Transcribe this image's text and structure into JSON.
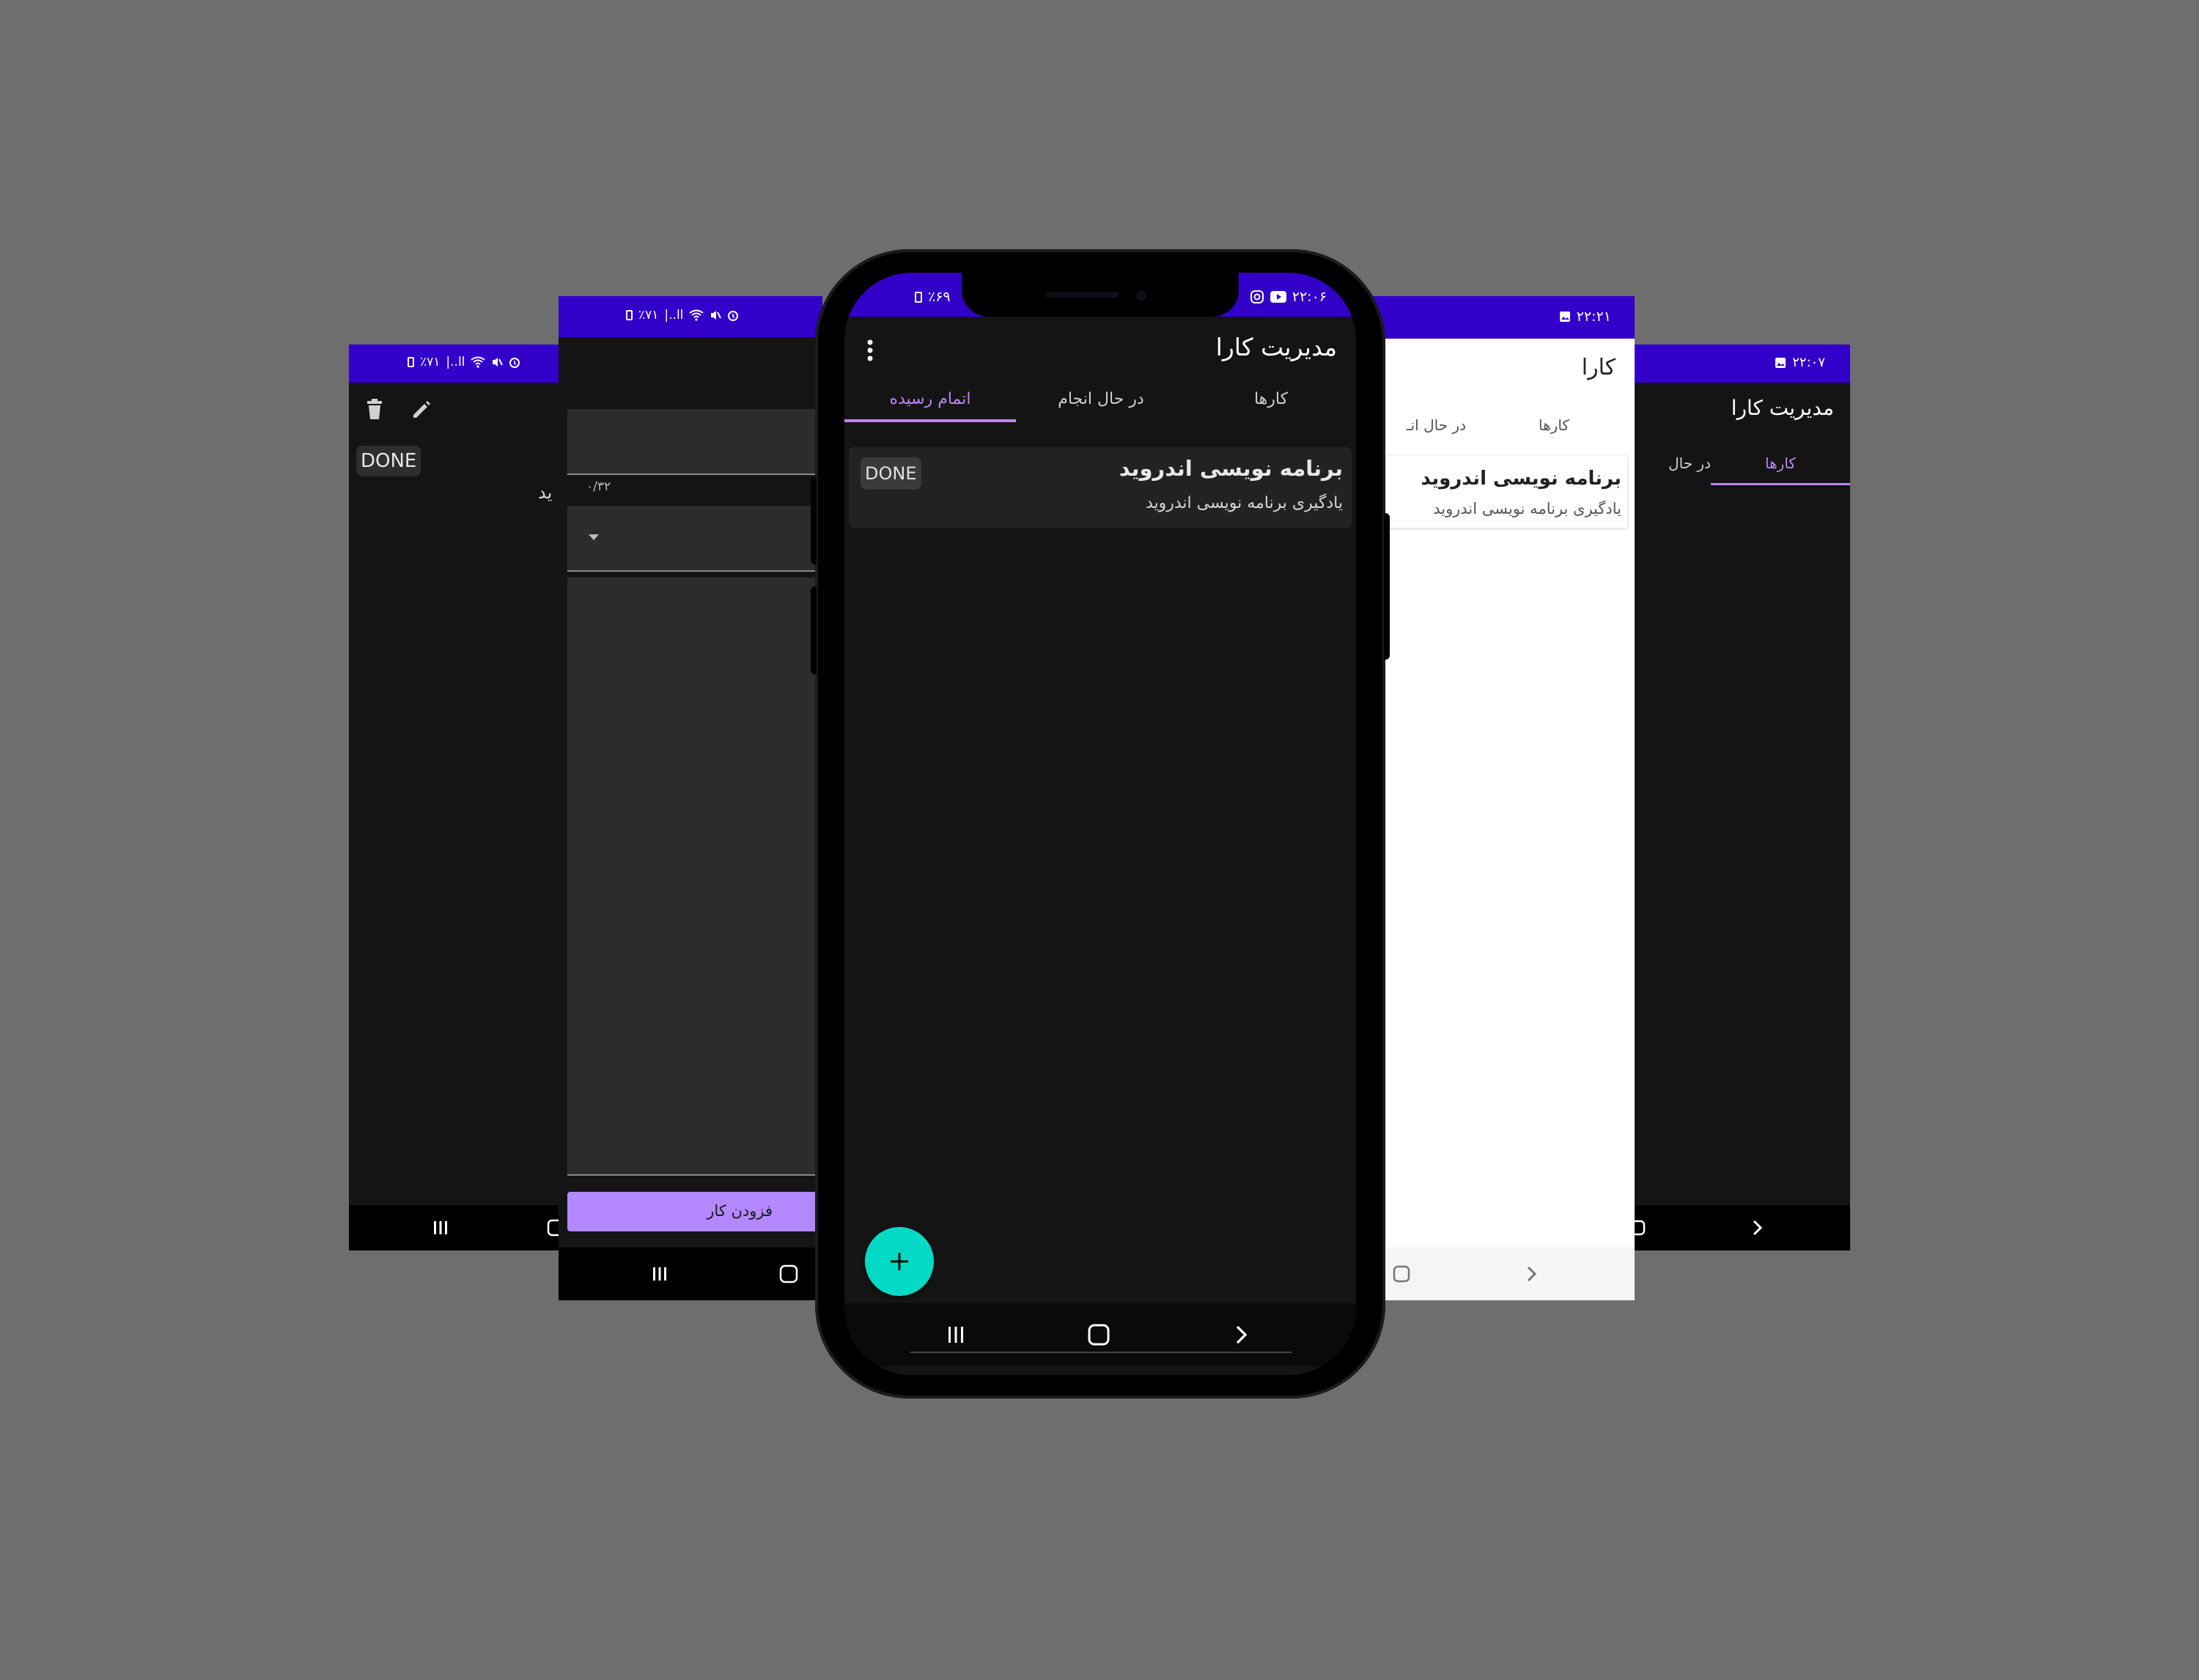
{
  "accent_purple": "#3200c8",
  "tab_accent": "#bb86fc",
  "fab_color": "#03dac5",
  "screen1": {
    "status": {
      "battery": "٪۷۱",
      "signal": "|..ll"
    },
    "done_label": "DONE",
    "partial_text": "ید"
  },
  "screen2": {
    "status": {
      "battery": "٪۷۱",
      "signal": "|..ll"
    },
    "char_counter": "۰/۳۲",
    "submit_button": "فزودن کار"
  },
  "main": {
    "status": {
      "time": "۲۲:۰۶",
      "battery": "٪۶۹"
    },
    "app_title": "مدیریت کارا",
    "tabs": [
      {
        "label": "کارها",
        "active": false
      },
      {
        "label": "در حال انجام",
        "active": false
      },
      {
        "label": "اتمام رسیده",
        "active": true
      }
    ],
    "task": {
      "title": "برنامه نویسی اندروید",
      "description": "یادگیری برنامه نویسی اندروید",
      "status_badge": "DONE"
    },
    "fab_icon": "plus-icon"
  },
  "screen4": {
    "status": {
      "time": "۲۲:۲۱"
    },
    "app_title_partial": "کارا",
    "tabs": [
      "کارها",
      "در حال انـ"
    ],
    "task": {
      "title": "برنامه نویسی اندروید",
      "description": "یادگیری برنامه نویسی اندروید"
    }
  },
  "screen5": {
    "status": {
      "time": "۲۲:۰۷"
    },
    "app_title": "مدیریت کارا",
    "tabs": [
      "کارها",
      "در حال"
    ]
  }
}
